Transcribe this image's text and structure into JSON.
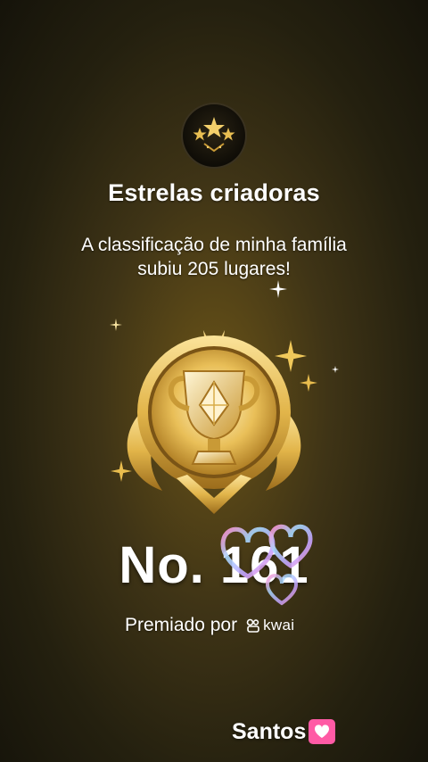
{
  "card": {
    "title": "Estrelas criadoras",
    "subtitle_line1": "A classificação de minha família",
    "subtitle_line2": "subiu 205 lugares!",
    "rank": "No. 161",
    "awarded_by_label": "Premiado por",
    "brand": "kwai"
  },
  "icons": {
    "badge": "three-stars-icon",
    "trophy": "gold-trophy-emblem-icon",
    "hearts": "iridescent-hearts-sticker-icon",
    "kwai": "kwai-logo-icon",
    "heart": "pink-heart-icon"
  },
  "watermark": {
    "text": "Santos"
  },
  "colors": {
    "gold": "#e2b54a",
    "gold_dark": "#9c6d1c",
    "background_center": "#6b5418",
    "background_edge": "#15130a",
    "heart_pink": "#ff4d9d",
    "text": "#ffffff"
  }
}
